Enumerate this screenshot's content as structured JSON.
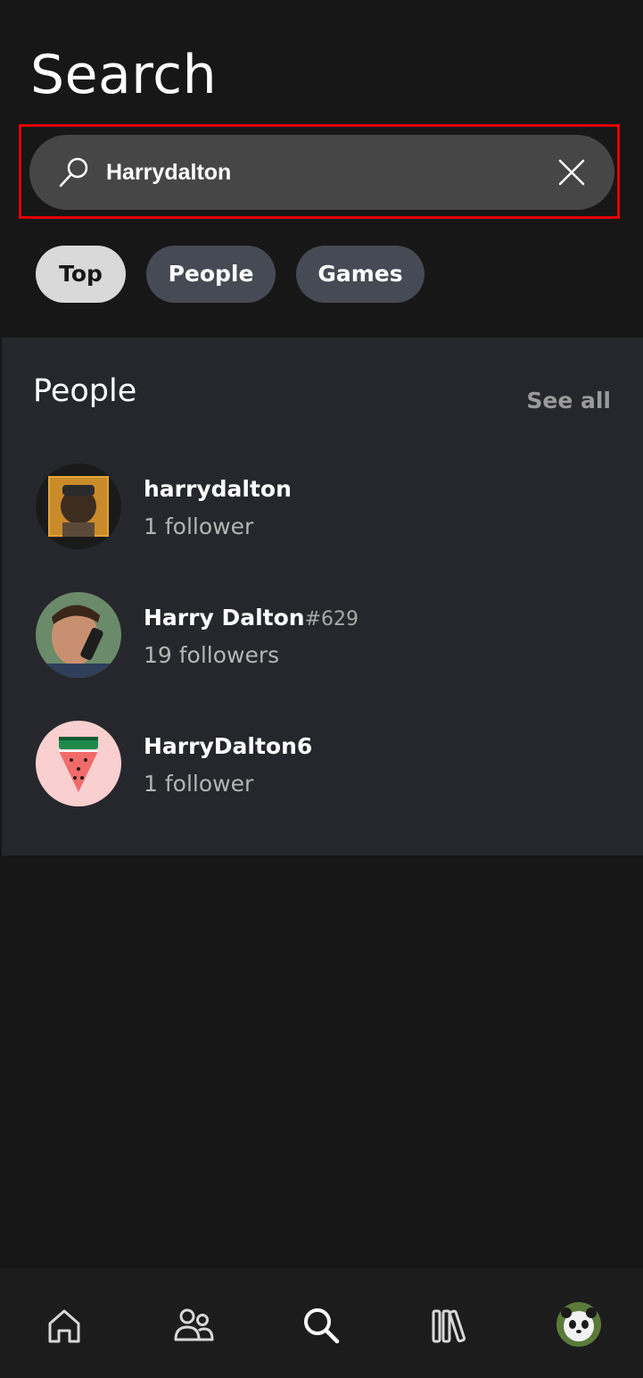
{
  "header": {
    "title": "Search"
  },
  "search": {
    "query": "Harrydalton"
  },
  "filters": [
    {
      "label": "Top",
      "selected": true
    },
    {
      "label": "People",
      "selected": false
    },
    {
      "label": "Games",
      "selected": false
    }
  ],
  "people_section": {
    "title": "People",
    "see_all_label": "See all",
    "results": [
      {
        "name": "harrydalton",
        "tag": "",
        "followers": "1 follower"
      },
      {
        "name": "Harry Dalton",
        "tag": "#629",
        "followers": "19 followers"
      },
      {
        "name": "HarryDalton6",
        "tag": "",
        "followers": "1 follower"
      }
    ]
  },
  "bottom_nav": {
    "items": [
      "home-icon",
      "social-icon",
      "search-icon",
      "library-icon",
      "profile-avatar"
    ],
    "active": "search-icon"
  },
  "colors": {
    "background": "#171717",
    "search_bar": "#464646",
    "highlight": "#e00000",
    "selected_pill": "#d9d9d9",
    "pill": "#454a54",
    "section": "#26272c"
  }
}
